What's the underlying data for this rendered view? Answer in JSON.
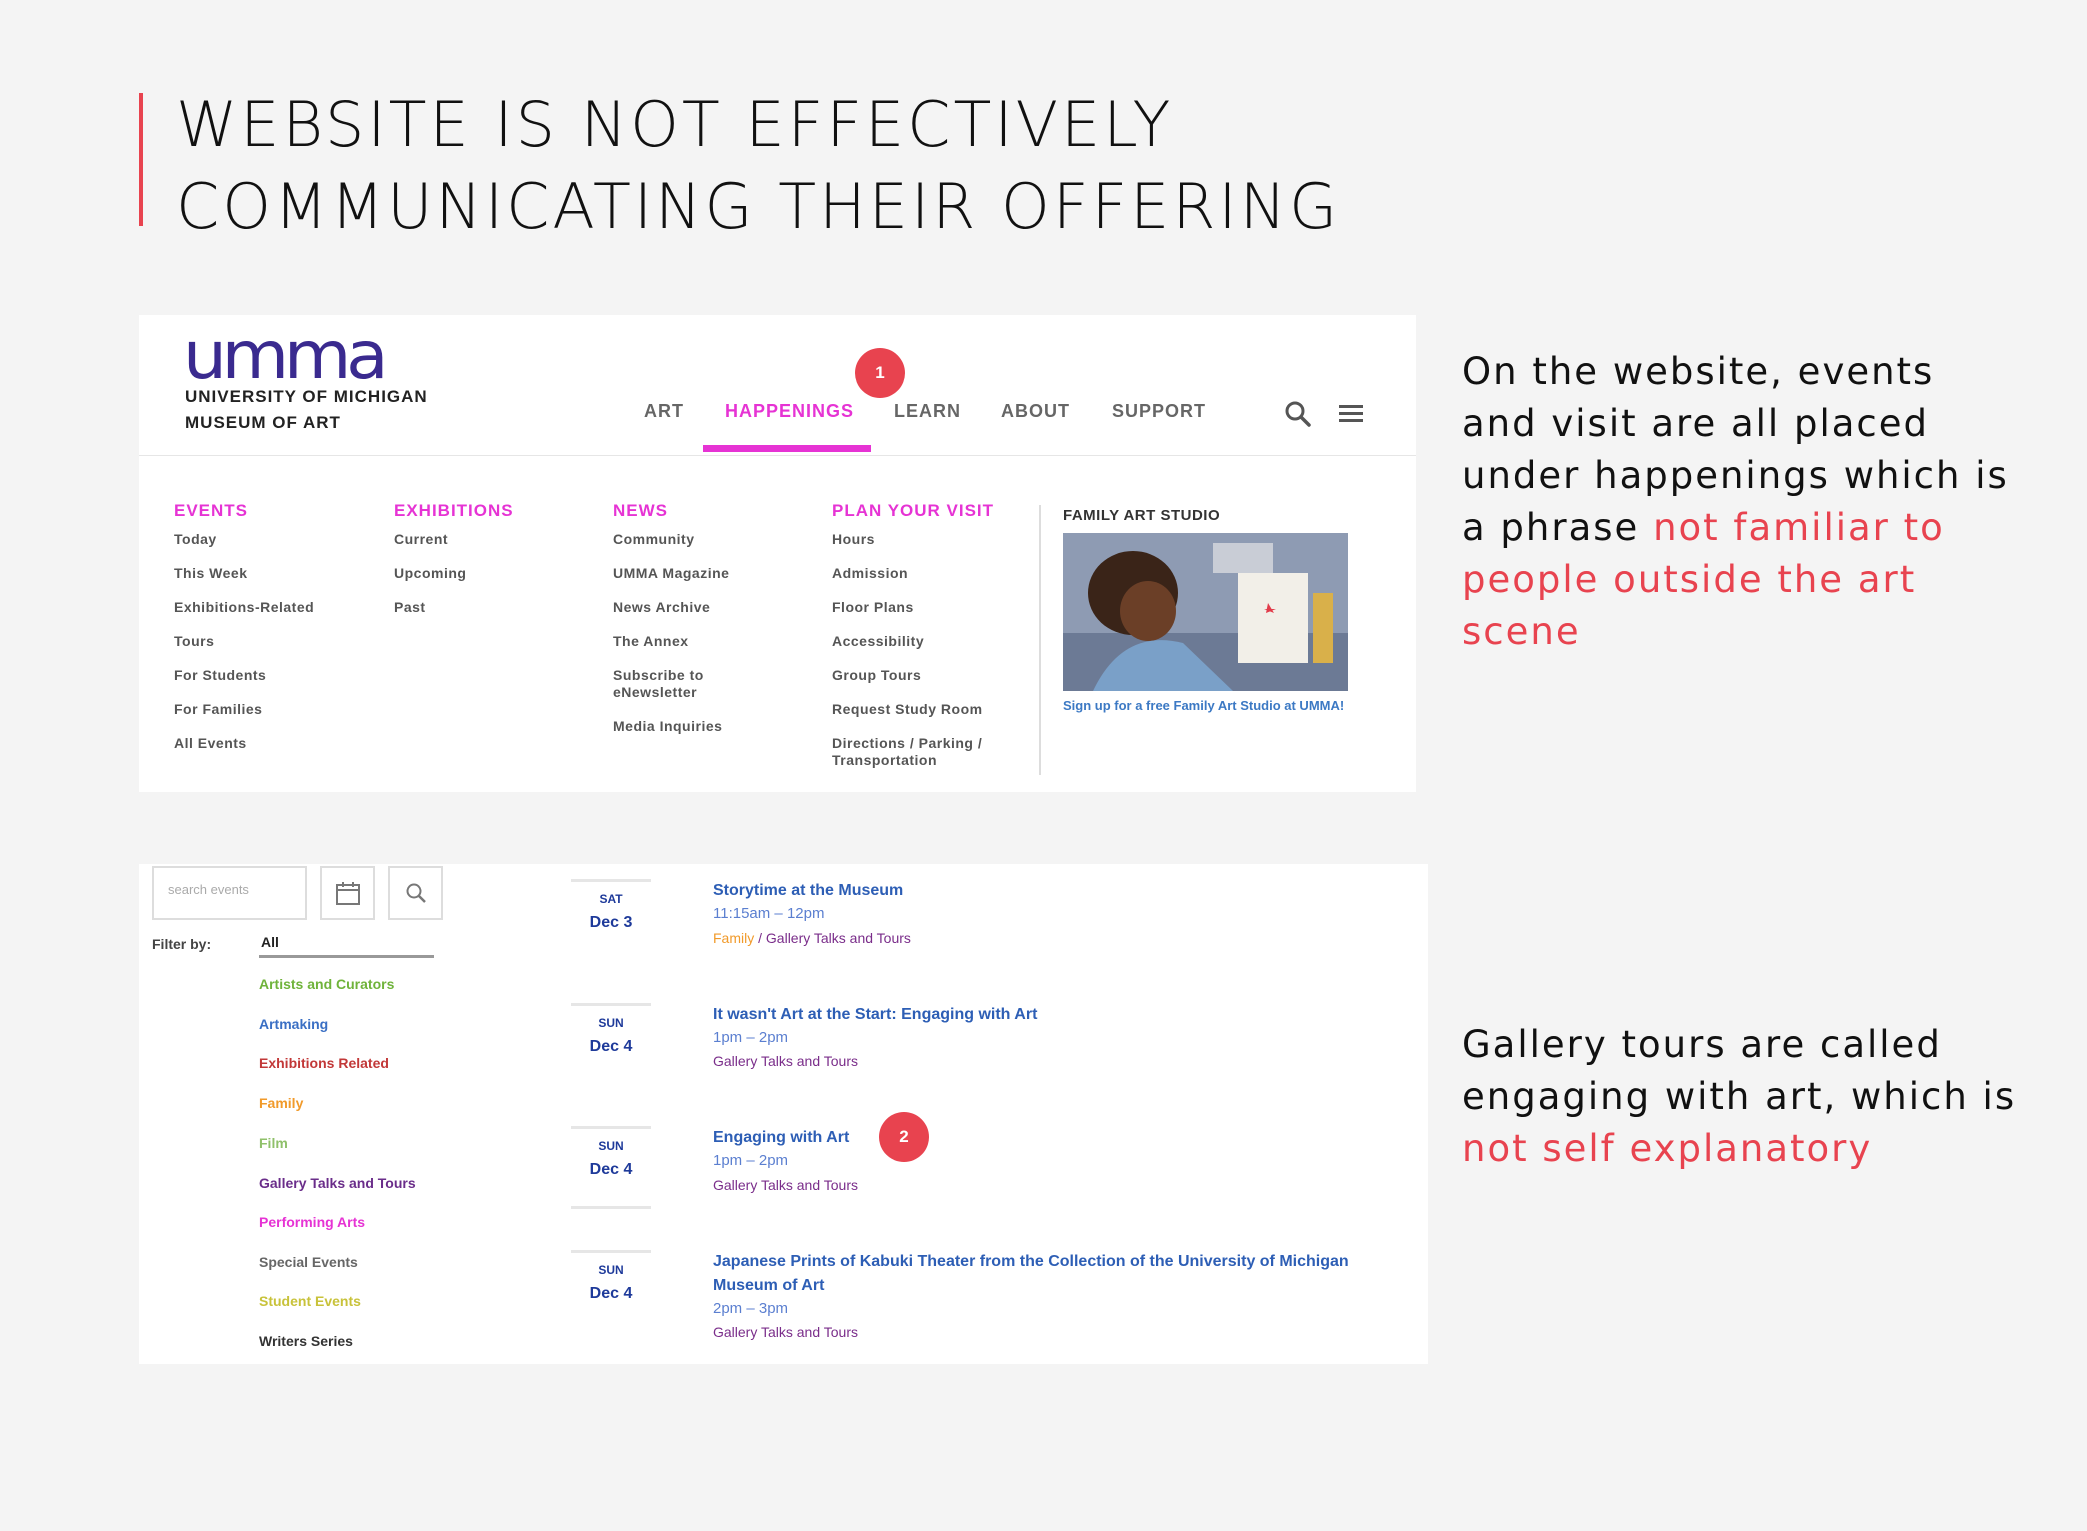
{
  "title": {
    "line1": "WEBSITE IS NOT EFFECTIVELY",
    "line2": "COMMUNICATING THEIR OFFERING"
  },
  "website": {
    "logo": "umma",
    "logo_sub_line1": "UNIVERSITY OF MICHIGAN",
    "logo_sub_line2": "MUSEUM OF ART",
    "nav": [
      "ART",
      "HAPPENINGS",
      "LEARN",
      "ABOUT",
      "SUPPORT"
    ],
    "active_nav": "HAPPENINGS",
    "badge": "1",
    "menu": {
      "events": {
        "heading": "EVENTS",
        "items": [
          "Today",
          "This Week",
          "Exhibitions-Related",
          "Tours",
          "For Students",
          "For Families",
          "All Events"
        ]
      },
      "exhibitions": {
        "heading": "EXHIBITIONS",
        "items": [
          "Current",
          "Upcoming",
          "Past"
        ]
      },
      "news": {
        "heading": "NEWS",
        "items": [
          "Community",
          "UMMA Magazine",
          "News Archive",
          "The Annex",
          "Subscribe to eNewsletter",
          "Media Inquiries"
        ]
      },
      "visit": {
        "heading": "PLAN YOUR VISIT",
        "items": [
          "Hours",
          "Admission",
          "Floor Plans",
          "Accessibility",
          "Group Tours",
          "Request Study Room",
          "Directions / Parking / Transportation"
        ]
      }
    },
    "feature": {
      "title": "FAMILY ART STUDIO",
      "caption": "Sign up for a free Family Art Studio at UMMA!"
    }
  },
  "events_page": {
    "search_placeholder": "search events",
    "filter_label": "Filter by:",
    "filter_value": "All",
    "categories": [
      {
        "label": "Artists and Curators",
        "color": "#6fb33a"
      },
      {
        "label": "Artmaking",
        "color": "#3a6fc4"
      },
      {
        "label": "Exhibitions Related",
        "color": "#c23838"
      },
      {
        "label": "Family",
        "color": "#f19a2a"
      },
      {
        "label": "Film",
        "color": "#8fc06a"
      },
      {
        "label": "Gallery Talks and Tours",
        "color": "#6a2d8a"
      },
      {
        "label": "Performing Arts",
        "color": "#e633d4"
      },
      {
        "label": "Special Events",
        "color": "#666666"
      },
      {
        "label": "Student Events",
        "color": "#c8c23a"
      },
      {
        "label": "Writers Series",
        "color": "#333333"
      }
    ],
    "badge": "2",
    "events": [
      {
        "day": "SAT",
        "date": "Dec 3",
        "title": "Storytime at the Museum",
        "time": "11:15am – 12pm",
        "cat_family": "Family",
        "cat_rest": " / Gallery Talks and Tours"
      },
      {
        "day": "SUN",
        "date": "Dec 4",
        "title": "It wasn't Art at the Start: Engaging with Art",
        "time": "1pm – 2pm",
        "cat": "Gallery Talks and Tours"
      },
      {
        "day": "SUN",
        "date": "Dec 4",
        "title": "Engaging with Art",
        "time": "1pm – 2pm",
        "cat": "Gallery Talks and Tours"
      },
      {
        "day": "SUN",
        "date": "Dec 4",
        "title": "Japanese Prints of Kabuki Theater from the Collection of the University of Michigan Museum of Art",
        "time": "2pm – 3pm",
        "cat": "Gallery Talks and Tours"
      }
    ]
  },
  "notes": {
    "note1_plain": "On the website, events and visit are all placed under happenings which is a phrase ",
    "note1_highlight": "not familiar to people outside the art scene",
    "note2_plain": "Gallery tours are called engaging with art, which is ",
    "note2_highlight": "not self explanatory"
  },
  "colors": {
    "accent": "#e8434f",
    "magenta": "#e633d4",
    "logo_purple": "#3a2a8f",
    "event_blue": "#2d5eb5"
  }
}
